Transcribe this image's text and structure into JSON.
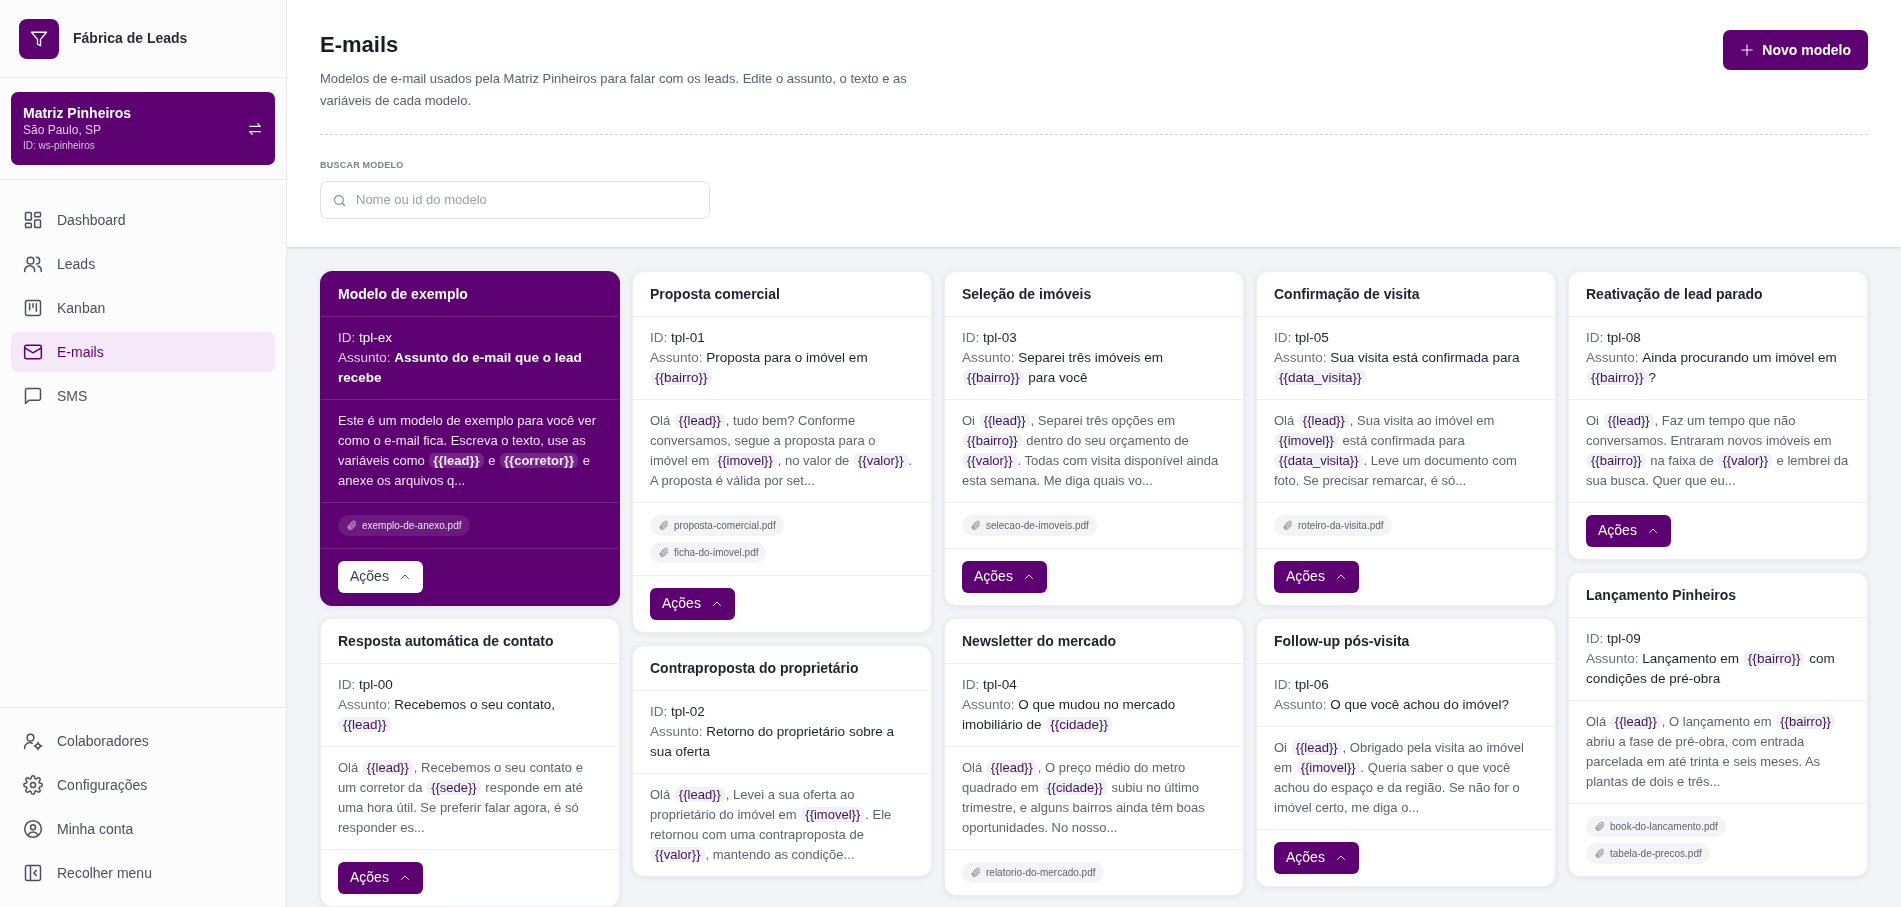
{
  "brand": {
    "name": "Fábrica de Leads"
  },
  "workspace": {
    "name": "Matriz Pinheiros",
    "location": "São Paulo, SP",
    "id": "ID: ws-pinheiros"
  },
  "nav": [
    {
      "label": "Dashboard",
      "selected": false
    },
    {
      "label": "Leads",
      "selected": false
    },
    {
      "label": "Kanban",
      "selected": false
    },
    {
      "label": "E-mails",
      "selected": true
    },
    {
      "label": "SMS",
      "selected": false
    }
  ],
  "footer_nav": [
    {
      "label": "Colaboradores"
    },
    {
      "label": "Configurações"
    },
    {
      "label": "Minha conta"
    },
    {
      "label": "Recolher menu"
    }
  ],
  "header": {
    "title": "E-mails",
    "description": "Modelos de e-mail usados pela Matriz Pinheiros para falar com os leads. Edite o assunto, o texto e as variáveis de cada modelo.",
    "new_button": "Novo modelo",
    "search_label": "BUSCAR MODELO",
    "search_placeholder": "Nome ou id do modelo"
  },
  "columns": [
    [
      {
        "title": "Modelo de exemplo",
        "selected": true,
        "id_label": "ID:",
        "id": "tpl-ex",
        "subject_label": "Assunto:",
        "subject": [
          {
            "kind": "text",
            "text": "Assunto do e-mail que o lead recebe"
          }
        ],
        "body": [
          {
            "kind": "text",
            "text": "Este é um modelo de exemplo para você ver como o e-mail fica. Escreva o texto, use as variáveis como "
          },
          {
            "kind": "variable",
            "text": "{{lead}}"
          },
          {
            "kind": "text",
            "text": " e "
          },
          {
            "kind": "variable",
            "text": "{{corretor}}"
          },
          {
            "kind": "text",
            "text": " e anexe os arquivos q..."
          }
        ],
        "attachments": [
          "exemplo-de-anexo.pdf"
        ],
        "actions": "Ações"
      },
      {
        "title": "Resposta automática de contato",
        "selected": false,
        "id_label": "ID:",
        "id": "tpl-00",
        "subject_label": "Assunto:",
        "subject": [
          {
            "kind": "text",
            "text": "Recebemos o seu contato, "
          },
          {
            "kind": "variable",
            "text": "{{lead}}"
          }
        ],
        "body": [
          {
            "kind": "text",
            "text": "Olá "
          },
          {
            "kind": "variable",
            "text": "{{lead}}"
          },
          {
            "kind": "text",
            "text": ", Recebemos o seu contato e um corretor da "
          },
          {
            "kind": "variable",
            "text": "{{sede}}"
          },
          {
            "kind": "text",
            "text": " responde em até uma hora útil. Se preferir falar agora, é só responder es..."
          }
        ],
        "actions": "Ações"
      }
    ],
    [
      {
        "title": "Proposta comercial",
        "selected": false,
        "id_label": "ID:",
        "id": "tpl-01",
        "subject_label": "Assunto:",
        "subject": [
          {
            "kind": "text",
            "text": "Proposta para o imóvel em "
          },
          {
            "kind": "variable",
            "text": "{{bairro}}"
          }
        ],
        "body": [
          {
            "kind": "text",
            "text": "Olá "
          },
          {
            "kind": "variable",
            "text": "{{lead}}"
          },
          {
            "kind": "text",
            "text": ", tudo bem? Conforme conversamos, segue a proposta para o imóvel em "
          },
          {
            "kind": "variable",
            "text": "{{imovel}}"
          },
          {
            "kind": "text",
            "text": ", no valor de "
          },
          {
            "kind": "variable",
            "text": "{{valor}}"
          },
          {
            "kind": "text",
            "text": ". A proposta é válida por set..."
          }
        ],
        "attachments": [
          "proposta-comercial.pdf",
          "ficha-do-imovel.pdf"
        ],
        "actions": "Ações"
      },
      {
        "title": "Contraproposta do proprietário",
        "selected": false,
        "id_label": "ID:",
        "id": "tpl-02",
        "subject_label": "Assunto:",
        "subject": [
          {
            "kind": "text",
            "text": "Retorno do proprietário sobre a sua oferta"
          }
        ],
        "body": [
          {
            "kind": "text",
            "text": "Olá "
          },
          {
            "kind": "variable",
            "text": "{{lead}}"
          },
          {
            "kind": "text",
            "text": ", Levei a sua oferta ao proprietário do imóvel em "
          },
          {
            "kind": "variable",
            "text": "{{imovel}}"
          },
          {
            "kind": "text",
            "text": ". Ele retornou com uma contraproposta de "
          },
          {
            "kind": "variable",
            "text": "{{valor}}"
          },
          {
            "kind": "text",
            "text": ", mantendo as condiçõe..."
          }
        ]
      }
    ],
    [
      {
        "title": "Seleção de imóveis",
        "selected": false,
        "id_label": "ID:",
        "id": "tpl-03",
        "subject_label": "Assunto:",
        "subject": [
          {
            "kind": "text",
            "text": "Separei três imóveis em "
          },
          {
            "kind": "variable",
            "text": "{{bairro}}"
          },
          {
            "kind": "text",
            "text": " para você"
          }
        ],
        "body": [
          {
            "kind": "text",
            "text": "Oi "
          },
          {
            "kind": "variable",
            "text": "{{lead}}"
          },
          {
            "kind": "text",
            "text": ", Separei três opções em "
          },
          {
            "kind": "variable",
            "text": "{{bairro}}"
          },
          {
            "kind": "text",
            "text": " dentro do seu orçamento de "
          },
          {
            "kind": "variable",
            "text": "{{valor}}"
          },
          {
            "kind": "text",
            "text": ". Todas com visita disponível ainda esta semana. Me diga quais vo..."
          }
        ],
        "attachments": [
          "selecao-de-imoveis.pdf"
        ],
        "actions": "Ações"
      },
      {
        "title": "Newsletter do mercado",
        "selected": false,
        "id_label": "ID:",
        "id": "tpl-04",
        "subject_label": "Assunto:",
        "subject": [
          {
            "kind": "text",
            "text": "O que mudou no mercado imobiliário de "
          },
          {
            "kind": "variable",
            "text": "{{cidade}}"
          }
        ],
        "body": [
          {
            "kind": "text",
            "text": "Olá "
          },
          {
            "kind": "variable",
            "text": "{{lead}}"
          },
          {
            "kind": "text",
            "text": ", O preço médio do metro quadrado em "
          },
          {
            "kind": "variable",
            "text": "{{cidade}}"
          },
          {
            "kind": "text",
            "text": " subiu no último trimestre, e alguns bairros ainda têm boas oportunidades. No nosso..."
          }
        ],
        "attachments": [
          "relatorio-do-mercado.pdf"
        ]
      }
    ],
    [
      {
        "title": "Confirmação de visita",
        "selected": false,
        "id_label": "ID:",
        "id": "tpl-05",
        "subject_label": "Assunto:",
        "subject": [
          {
            "kind": "text",
            "text": "Sua visita está confirmada para "
          },
          {
            "kind": "variable",
            "text": "{{data_visita}}"
          }
        ],
        "body": [
          {
            "kind": "text",
            "text": "Olá "
          },
          {
            "kind": "variable",
            "text": "{{lead}}"
          },
          {
            "kind": "text",
            "text": ", Sua visita ao imóvel em "
          },
          {
            "kind": "variable",
            "text": "{{imovel}}"
          },
          {
            "kind": "text",
            "text": " está confirmada para "
          },
          {
            "kind": "variable",
            "text": "{{data_visita}}"
          },
          {
            "kind": "text",
            "text": ". Leve um documento com foto. Se precisar remarcar, é só..."
          }
        ],
        "attachments": [
          "roteiro-da-visita.pdf"
        ],
        "actions": "Ações"
      },
      {
        "title": "Follow-up pós-visita",
        "selected": false,
        "id_label": "ID:",
        "id": "tpl-06",
        "subject_label": "Assunto:",
        "subject": [
          {
            "kind": "text",
            "text": "O que você achou do imóvel?"
          }
        ],
        "body": [
          {
            "kind": "text",
            "text": "Oi "
          },
          {
            "kind": "variable",
            "text": "{{lead}}"
          },
          {
            "kind": "text",
            "text": ", Obrigado pela visita ao imóvel em "
          },
          {
            "kind": "variable",
            "text": "{{imovel}}"
          },
          {
            "kind": "text",
            "text": ". Queria saber o que você achou do espaço e da região. Se não for o imóvel certo, me diga o..."
          }
        ],
        "actions": "Ações"
      }
    ],
    [
      {
        "title": "Reativação de lead parado",
        "selected": false,
        "id_label": "ID:",
        "id": "tpl-08",
        "subject_label": "Assunto:",
        "subject": [
          {
            "kind": "text",
            "text": "Ainda procurando um imóvel em "
          },
          {
            "kind": "variable",
            "text": "{{bairro}}"
          },
          {
            "kind": "text",
            "text": "?"
          }
        ],
        "body": [
          {
            "kind": "text",
            "text": "Oi "
          },
          {
            "kind": "variable",
            "text": "{{lead}}"
          },
          {
            "kind": "text",
            "text": ", Faz um tempo que não conversamos. Entraram novos imóveis em "
          },
          {
            "kind": "variable",
            "text": "{{bairro}}"
          },
          {
            "kind": "text",
            "text": " na faixa de "
          },
          {
            "kind": "variable",
            "text": "{{valor}}"
          },
          {
            "kind": "text",
            "text": " e lembrei da sua busca. Quer que eu..."
          }
        ],
        "actions": "Ações"
      },
      {
        "title": "Lançamento Pinheiros",
        "selected": false,
        "id_label": "ID:",
        "id": "tpl-09",
        "subject_label": "Assunto:",
        "subject": [
          {
            "kind": "text",
            "text": "Lançamento em "
          },
          {
            "kind": "variable",
            "text": "{{bairro}}"
          },
          {
            "kind": "text",
            "text": " com condições de pré-obra"
          }
        ],
        "body": [
          {
            "kind": "text",
            "text": "Olá "
          },
          {
            "kind": "variable",
            "text": "{{lead}}"
          },
          {
            "kind": "text",
            "text": ", O lançamento em "
          },
          {
            "kind": "variable",
            "text": "{{bairro}}"
          },
          {
            "kind": "text",
            "text": " abriu a fase de pré-obra, com entrada parcelada em até trinta e seis meses. As plantas de dois e três..."
          }
        ],
        "attachments": [
          "book-do-lancamento.pdf",
          "tabela-de-precos.pdf"
        ]
      }
    ]
  ]
}
